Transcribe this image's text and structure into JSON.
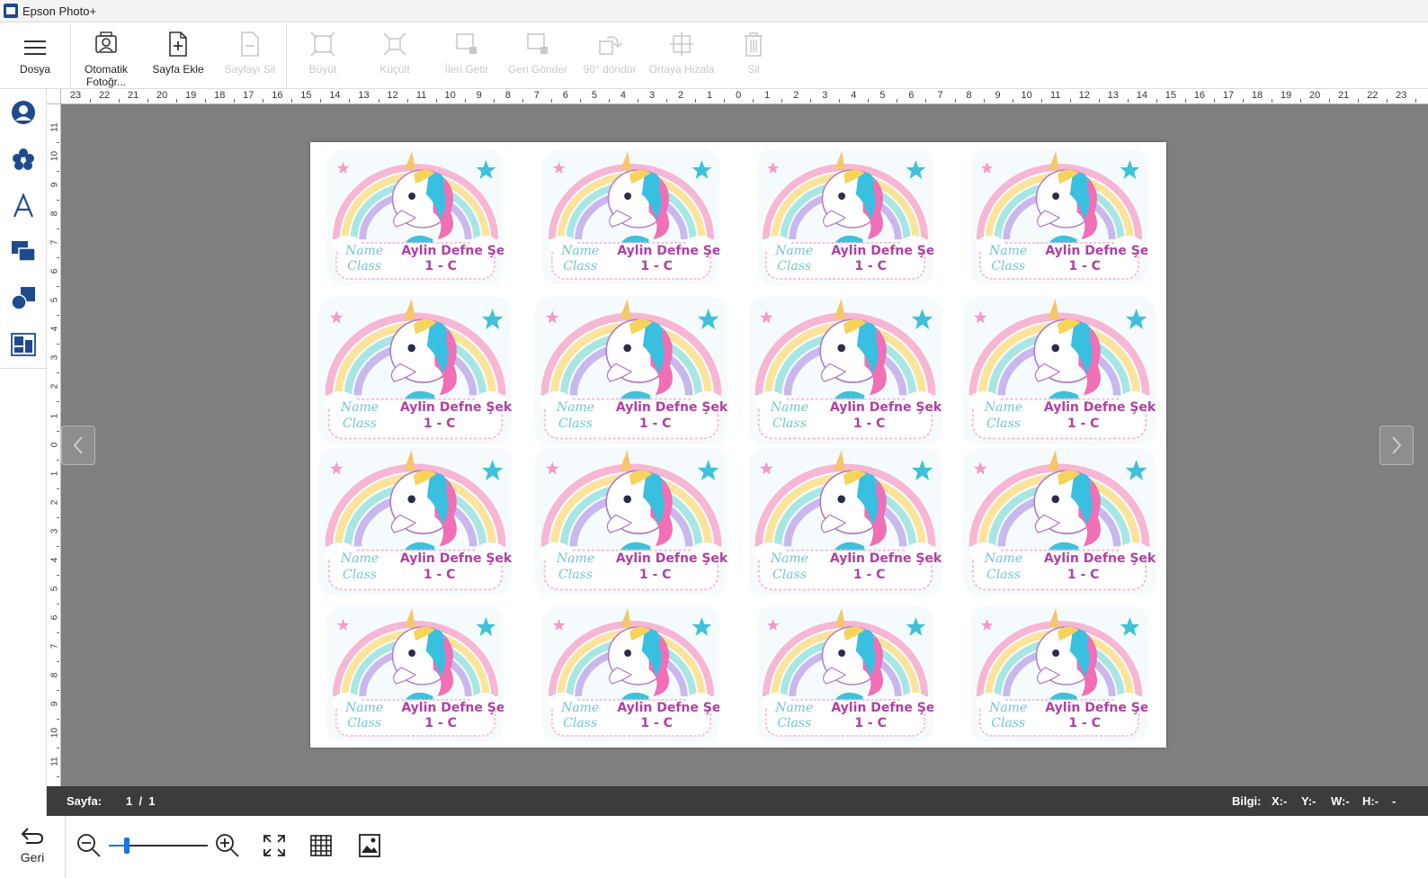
{
  "window": {
    "title": "Epson Photo+"
  },
  "toolbar": {
    "menu_label": "Dosya",
    "buttons": [
      {
        "label": "Otomatik Fotoğr...",
        "icon": "auto-photo-icon",
        "enabled": true
      },
      {
        "label": "Sayfa Ekle",
        "icon": "add-page-icon",
        "enabled": true
      },
      {
        "label": "Sayfayı Sil",
        "icon": "delete-page-icon",
        "enabled": false
      },
      {
        "label": "Büyüt",
        "icon": "enlarge-icon",
        "enabled": false
      },
      {
        "label": "Küçült",
        "icon": "shrink-icon",
        "enabled": false
      },
      {
        "label": "İleri Getir",
        "icon": "bring-forward-icon",
        "enabled": false
      },
      {
        "label": "Geri Gönder",
        "icon": "send-backward-icon",
        "enabled": false
      },
      {
        "label": "90° döndür",
        "icon": "rotate-90-icon",
        "enabled": false
      },
      {
        "label": "Ortaya Hizala",
        "icon": "center-align-icon",
        "enabled": false
      },
      {
        "label": "Sil",
        "icon": "trash-icon",
        "enabled": false
      }
    ]
  },
  "sidebar": {
    "items": [
      {
        "icon": "person-icon"
      },
      {
        "icon": "flower-stamp-icon"
      },
      {
        "icon": "text-icon"
      },
      {
        "icon": "layers-icon"
      },
      {
        "icon": "shapes-icon"
      },
      {
        "icon": "layout-icon"
      }
    ]
  },
  "rulers": {
    "top_labels": [
      "23",
      "22",
      "21",
      "20",
      "19",
      "18",
      "17",
      "16",
      "15",
      "14",
      "13",
      "12",
      "11",
      "10",
      "9",
      "8",
      "7",
      "6",
      "5",
      "4",
      "3",
      "2",
      "1",
      "0",
      "1",
      "2",
      "3",
      "4",
      "5",
      "6",
      "7",
      "8",
      "9",
      "10",
      "11",
      "12",
      "13",
      "14",
      "15",
      "16",
      "17",
      "18",
      "19",
      "20",
      "21",
      "22",
      "23"
    ],
    "left_labels": [
      "11",
      "10",
      "9",
      "8",
      "7",
      "6",
      "5",
      "4",
      "3",
      "2",
      "1",
      "0",
      "1",
      "2",
      "3",
      "4",
      "5",
      "6",
      "7",
      "8",
      "9",
      "10",
      "11"
    ]
  },
  "labels": {
    "name_key": "Name",
    "name_value": "Aylin Defne Şeker",
    "class_key": "Class",
    "class_value": "1 - C",
    "grid_rows": 4,
    "grid_cols": 4
  },
  "colors": {
    "canvas_bg": "#7f7f7f",
    "status_bg": "#3c3c3c",
    "accent": "#1a73e8",
    "label_name": "#b03fa5",
    "label_key": "#6fc6d6"
  },
  "status": {
    "page_label": "Sayfa:",
    "page_value": "1  /  1",
    "info_label": "Bilgi:",
    "x": "X:-",
    "y": "Y:-",
    "w": "W:-",
    "h": "H:-",
    "extra": "-"
  },
  "bottom": {
    "back_label": "Geri",
    "zoom_level": 0.18
  }
}
